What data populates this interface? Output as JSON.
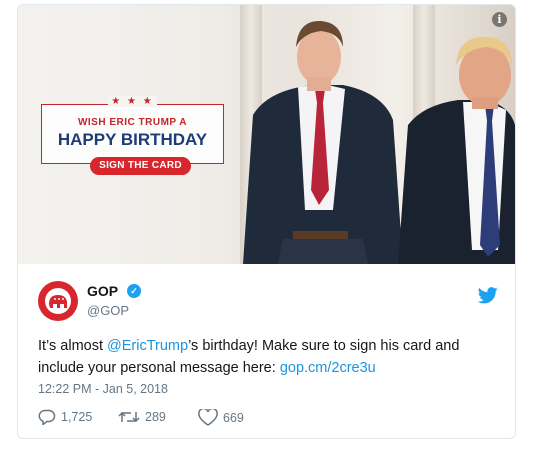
{
  "media": {
    "banner": {
      "stars": "★ ★ ★",
      "wish": "WISH ERIC TRUMP A",
      "happy": "HAPPY BIRTHDAY",
      "sign": "SIGN THE CARD"
    },
    "info_icon": "i",
    "colors": {
      "red": "#c4242a",
      "navy": "#1d3c78"
    }
  },
  "tweet": {
    "author_name": "GOP",
    "author_handle": "@GOP",
    "verified_icon": "check-icon",
    "text_before": "It’s almost ",
    "mention": "@EricTrump",
    "text_middle": "’s birthday! Make sure to sign his card and include your personal message here: ",
    "url": "gop.cm/2cre3u",
    "timestamp": "12:22 PM - Jan 5, 2018",
    "replies": "1,725",
    "retweets": "289",
    "likes": "669"
  },
  "colors": {
    "twitter_blue": "#1da1f2",
    "link": "#1b95e0",
    "gop_red": "#d8262d"
  }
}
